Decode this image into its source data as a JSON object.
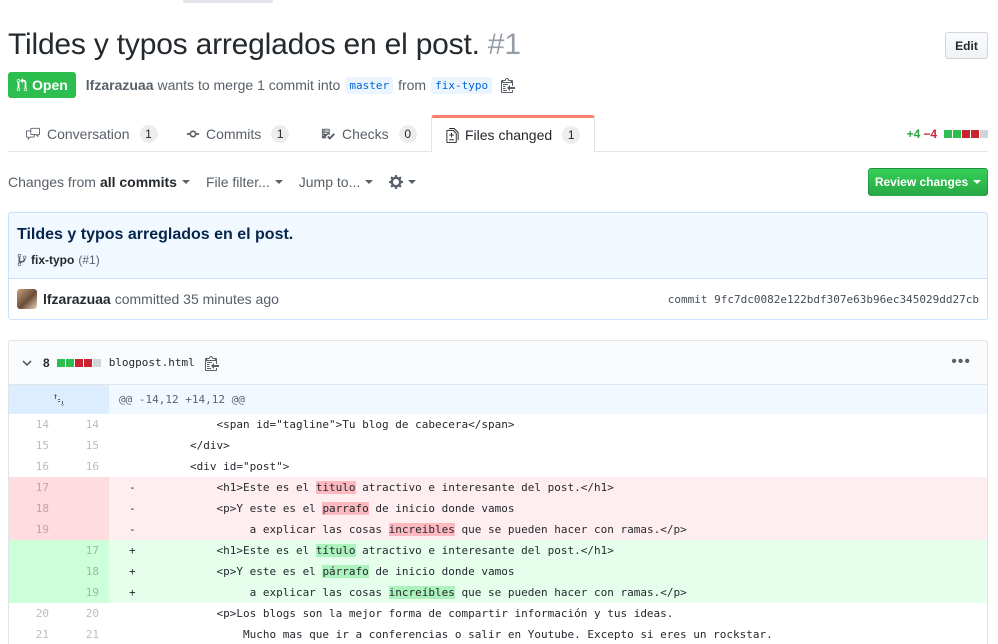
{
  "pr": {
    "title": "Tildes y typos arreglados en el post.",
    "number": "#1",
    "edit_label": "Edit",
    "state": "Open",
    "author": "lfzarazuaa",
    "merge_text": "wants to merge 1 commit into",
    "base_branch": "master",
    "from_text": "from",
    "head_branch": "fix-typo"
  },
  "tabs": [
    {
      "label": "Conversation",
      "count": "1"
    },
    {
      "label": "Commits",
      "count": "1"
    },
    {
      "label": "Checks",
      "count": "0"
    },
    {
      "label": "Files changed",
      "count": "1"
    }
  ],
  "diffstat": {
    "additions": "+4",
    "deletions": "−4"
  },
  "toolbar": {
    "changes_prefix": "Changes from",
    "changes_value": "all commits",
    "file_filter": "File filter...",
    "jump_to": "Jump to...",
    "review_label": "Review changes"
  },
  "commit": {
    "title": "Tildes y typos arreglados en el post.",
    "branch": "fix-typo",
    "branch_ref": "(#1)",
    "author": "lfzarazuaa",
    "time_text": "committed 35 minutes ago",
    "sha_text": "commit 9fc7dc0082e122bdf307e63b96ec345029dd27cb"
  },
  "file": {
    "changes": "8",
    "name": "blogpost.html",
    "hunk": "@@ -14,12 +14,12 @@"
  },
  "diff_lines": [
    {
      "type": "ctx",
      "old": "14",
      "new": "14",
      "pre": "            <span id=\"tagline\">Tu blog de cabecera</span>",
      "hl": "",
      "post": ""
    },
    {
      "type": "ctx",
      "old": "15",
      "new": "15",
      "pre": "        </div>",
      "hl": "",
      "post": ""
    },
    {
      "type": "ctx",
      "old": "16",
      "new": "16",
      "pre": "        <div id=\"post\">",
      "hl": "",
      "post": ""
    },
    {
      "type": "del",
      "old": "17",
      "new": "",
      "pre": "            <h1>Este es el ",
      "hl": "titulo",
      "post": " atractivo e interesante del post.</h1>"
    },
    {
      "type": "del",
      "old": "18",
      "new": "",
      "pre": "            <p>Y este es el ",
      "hl": "parrafo",
      "post": " de inicio donde vamos"
    },
    {
      "type": "del",
      "old": "19",
      "new": "",
      "pre": "                 a explicar las cosas ",
      "hl": "increibles",
      "post": " que se pueden hacer con ramas.</p>"
    },
    {
      "type": "add",
      "old": "",
      "new": "17",
      "pre": "            <h1>Este es el ",
      "hl": "título",
      "post": " atractivo e interesante del post.</h1>"
    },
    {
      "type": "add",
      "old": "",
      "new": "18",
      "pre": "            <p>Y este es el ",
      "hl": "párrafo",
      "post": " de inicio donde vamos"
    },
    {
      "type": "add",
      "old": "",
      "new": "19",
      "pre": "                 a explicar las cosas ",
      "hl": "increíbles",
      "post": " que se pueden hacer con ramas.</p>"
    },
    {
      "type": "ctx",
      "old": "20",
      "new": "20",
      "pre": "            <p>Los blogs son la mejor forma de compartir información y tus ideas.",
      "hl": "",
      "post": ""
    },
    {
      "type": "ctx",
      "old": "21",
      "new": "21",
      "pre": "                Mucho mas que ir a conferencias o salir en Youtube. Excepto si eres un rockstar.",
      "hl": "",
      "post": ""
    }
  ]
}
